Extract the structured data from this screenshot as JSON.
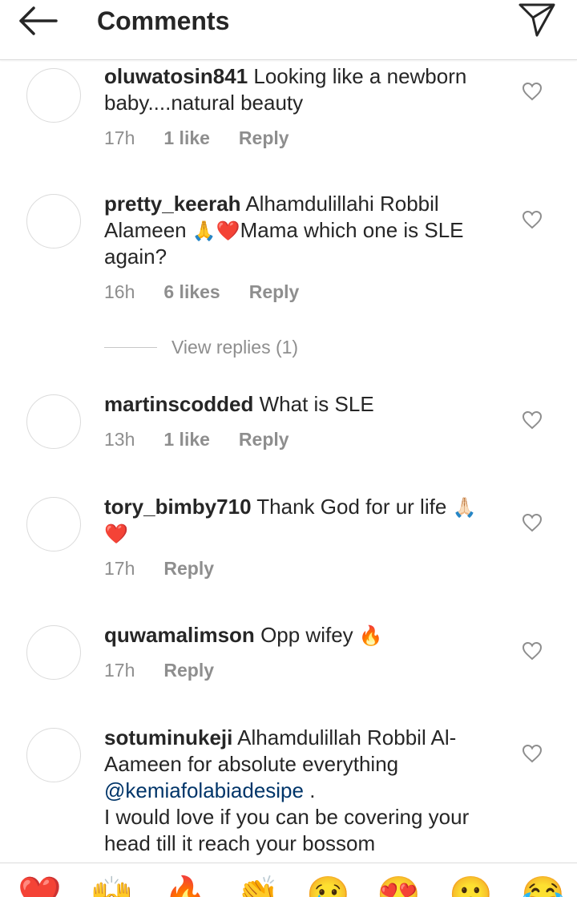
{
  "header": {
    "title": "Comments",
    "back_icon": "arrow-left-icon",
    "send_icon": "paper-plane-icon"
  },
  "comments": [
    {
      "username": "oluwatosin841",
      "text": "Looking like a newborn baby....natural beauty",
      "time": "17h",
      "likes": "1 like",
      "reply": "Reply"
    },
    {
      "username": "pretty_keerah",
      "text_a": "Alhamdulillahi Robbil Alameen ",
      "emoji_a": "🙏",
      "emoji_b": "❤️",
      "text_b": "Mama which one is SLE again?",
      "time": "16h",
      "likes": "6 likes",
      "reply": "Reply",
      "view_replies": "View replies (1)"
    },
    {
      "username": "martinscodded",
      "text": "What is SLE",
      "time": "13h",
      "likes": "1 like",
      "reply": "Reply"
    },
    {
      "username": "tory_bimby710",
      "text": "Thank God for ur life ",
      "emoji_a": "🙏🏻",
      "emoji_b": "❤️",
      "time": "17h",
      "reply": "Reply"
    },
    {
      "username": "quwamalimson",
      "text": "Opp wifey ",
      "emoji_a": "🔥",
      "time": "17h",
      "reply": "Reply"
    },
    {
      "username": "sotuminukeji",
      "text_a": "Alhamdulillah Robbil Al-Aameen for absolute everything",
      "mention": "@kemiafolabiadesipe",
      "text_b": " .",
      "text_c": "I would love if you can be covering your head till it reach your bossom"
    }
  ],
  "quick_emojis": [
    "❤️",
    "🙌",
    "🔥",
    "👏",
    "😢",
    "😍",
    "😮",
    "😂"
  ]
}
